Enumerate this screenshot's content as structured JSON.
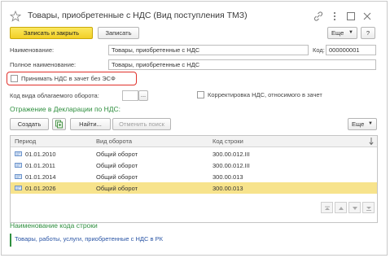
{
  "window": {
    "title": "Товары, приобретенные с НДС (Вид поступления ТМЗ)"
  },
  "toolbar": {
    "save_close_label": "Записать и закрыть",
    "save_label": "Записать",
    "more_label": "Еще",
    "help_label": "?"
  },
  "form": {
    "name_label": "Наименование:",
    "name_value": "Товары, приобретенные с НДС",
    "code_label": "Код:",
    "code_value": "000000001",
    "full_name_label": "Полное наименование:",
    "full_name_value": "Товары, приобретенные с НДС",
    "accept_vat_label": "Принимать НДС в зачет без ЭСФ",
    "turnover_code_label": "Код вида облагаемого оборота:",
    "turnover_code_value": "",
    "turnover_code_select": "...",
    "correction_label": "Корректировка НДС, относимого в зачет"
  },
  "declaration": {
    "section_title": "Отражение в Декларации по НДС:",
    "create_label": "Создать",
    "find_label": "Найти...",
    "cancel_search_label": "Отменить поиск",
    "more_label": "Еще",
    "columns": {
      "period": "Период",
      "turnover_type": "Вид оборота",
      "line_code": "Код строки"
    },
    "rows": [
      {
        "period": "01.01.2010",
        "turnover_type": "Общий оборот",
        "line_code": "300.00.012.III"
      },
      {
        "period": "01.01.2011",
        "turnover_type": "Общий оборот",
        "line_code": "300.00.012.III"
      },
      {
        "period": "01.01.2014",
        "turnover_type": "Общий оборот",
        "line_code": "300.00.013"
      },
      {
        "period": "01.01.2026",
        "turnover_type": "Общий оборот",
        "line_code": "300.00.013"
      }
    ]
  },
  "line_code_info": {
    "title": "Наименование кода строки",
    "value": "Товары, работы, услуги, приобретенные с НДС в РК"
  },
  "colors": {
    "accent_green": "#2f8f3f",
    "primary_button": "#f2cf26",
    "selected_row": "#f7e38c",
    "highlight_red": "#e0302a",
    "link_blue": "#2a55a5"
  },
  "icons": [
    "star-icon",
    "link-icon",
    "menu-icon",
    "restore-icon",
    "close-icon",
    "copy-icon",
    "sort-arrow-icon",
    "record-icon",
    "arrow-up-icon",
    "arrow-down-icon"
  ]
}
